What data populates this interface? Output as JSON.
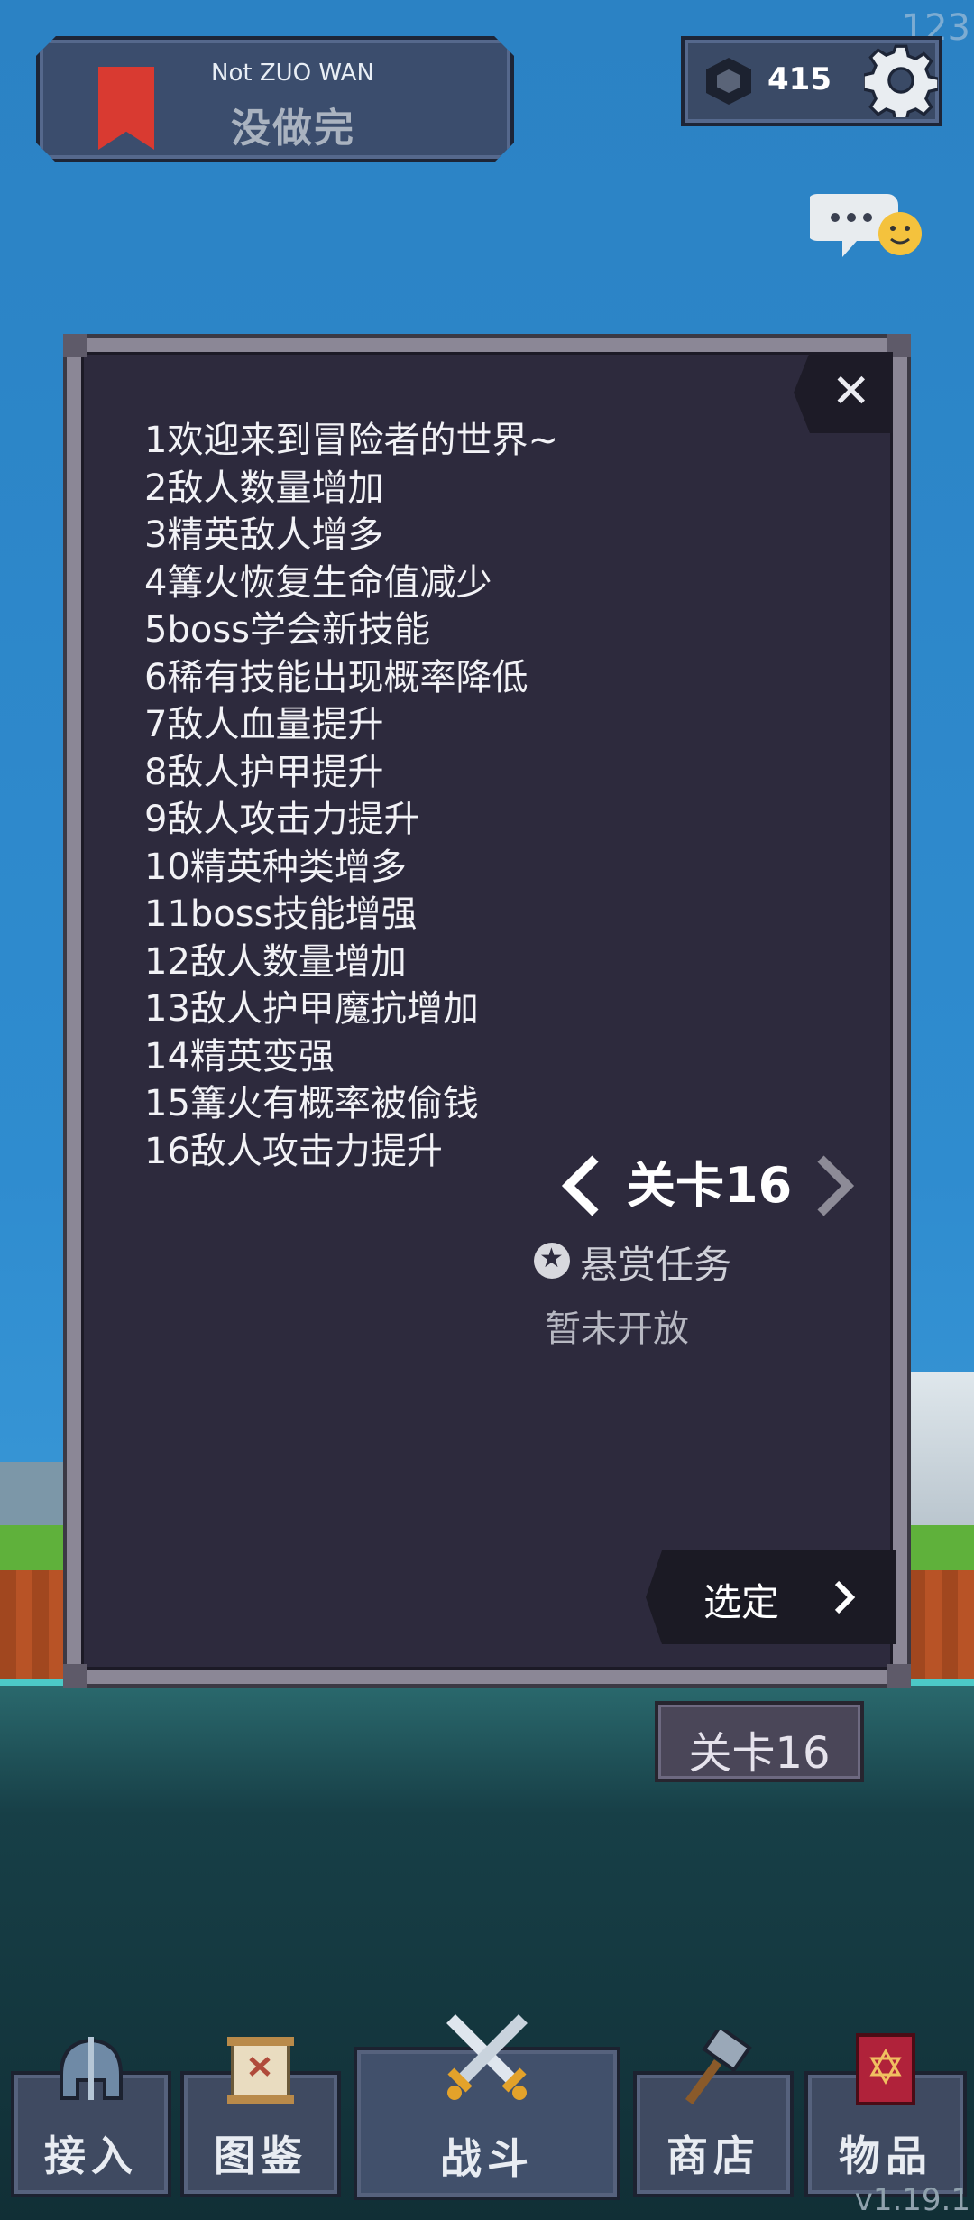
{
  "hud": {
    "watermark": "123",
    "version": "v1.19.1"
  },
  "quest": {
    "subtitle": "Not ZUO WAN",
    "title": "没做完"
  },
  "currency": {
    "gems": "415",
    "colors": {
      "bookmark": "#d93a31",
      "panel": "#2d2a3d"
    }
  },
  "dialog": {
    "close": "✕",
    "rules": [
      "1欢迎来到冒险者的世界~",
      "2敌人数量增加",
      "3精英敌人增多",
      "4篝火恢复生命值减少",
      "5boss学会新技能",
      "6稀有技能出现概率降低",
      "7敌人血量提升",
      "8敌人护甲提升",
      "9敌人攻击力提升",
      "10精英种类增多",
      "11boss技能增强",
      "12敌人数量增加",
      "13敌人护甲魔抗增加",
      "14精英变强",
      "15篝火有概率被偷钱",
      "16敌人攻击力提升"
    ],
    "stage": "关卡16",
    "bounty_label": "悬赏任务",
    "bounty_status": "暂未开放",
    "select_label": "选定"
  },
  "stage_badge": "关卡16",
  "nav": {
    "items": [
      {
        "label": "接入",
        "icon": "helmet-icon"
      },
      {
        "label": "图鉴",
        "icon": "scroll-icon"
      },
      {
        "label": "战斗",
        "icon": "crossed-swords-icon"
      },
      {
        "label": "商店",
        "icon": "hammer-icon"
      },
      {
        "label": "物品",
        "icon": "spellbook-icon"
      }
    ]
  }
}
